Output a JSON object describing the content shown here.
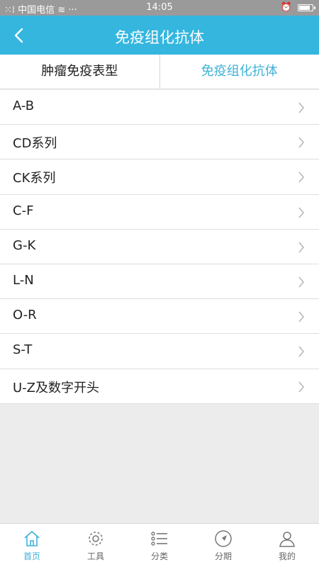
{
  "statusbar": {
    "left": "中国电信",
    "time": "14:05",
    "battery_level": 0.85
  },
  "header": {
    "title": "免疫组化抗体",
    "back_icon": "chevron-left-icon"
  },
  "tabs": [
    {
      "label": "肿瘤免疫表型",
      "active": false
    },
    {
      "label": "免疫组化抗体",
      "active": true
    }
  ],
  "list": [
    {
      "label": "A-B"
    },
    {
      "label": "CD系列"
    },
    {
      "label": "CK系列"
    },
    {
      "label": "C-F"
    },
    {
      "label": "G-K"
    },
    {
      "label": "L-N"
    },
    {
      "label": "O-R"
    },
    {
      "label": "S-T"
    },
    {
      "label": "U-Z及数字开头"
    }
  ],
  "bottom_nav": [
    {
      "label": "首页",
      "icon": "home-icon",
      "active": true
    },
    {
      "label": "工具",
      "icon": "gear-icon",
      "active": false
    },
    {
      "label": "分类",
      "icon": "list-icon",
      "active": false
    },
    {
      "label": "分期",
      "icon": "compass-icon",
      "active": false
    },
    {
      "label": "我的",
      "icon": "user-icon",
      "active": false
    }
  ],
  "colors": {
    "accent": "#34b6df",
    "active_text": "#3fb2d8"
  }
}
